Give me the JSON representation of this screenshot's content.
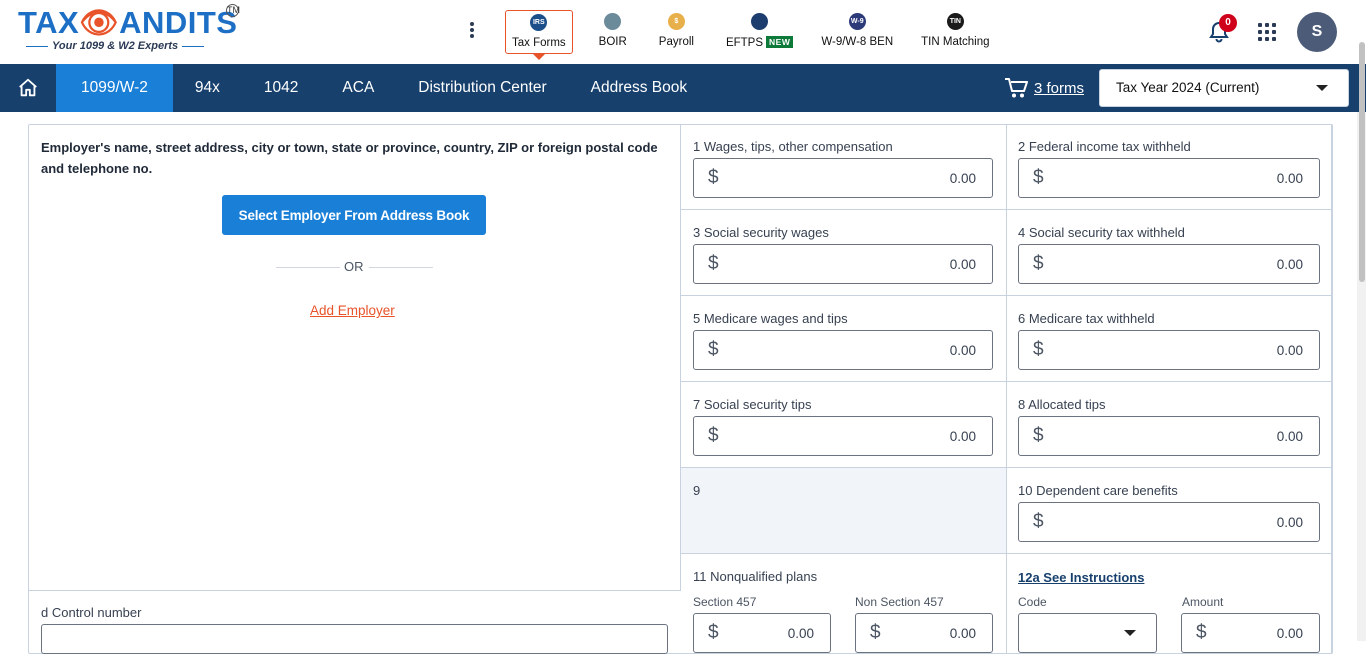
{
  "logo": {
    "brand_left": "TAX",
    "brand_right": "ANDITS",
    "tm": "TM",
    "tagline": "Your 1099 & W2 Experts"
  },
  "products": [
    {
      "label": "Tax Forms",
      "icon": "tax-forms-icon",
      "color": "#1c4f8a",
      "glyph": "IRS",
      "active": true
    },
    {
      "label": "BOIR",
      "icon": "boir-icon",
      "color": "#6b8a9a",
      "glyph": ""
    },
    {
      "label": "Payroll",
      "icon": "payroll-icon",
      "color": "#e8b04a",
      "glyph": "$"
    },
    {
      "label": "EFTPS",
      "icon": "eftps-icon",
      "color": "#1c3d6d",
      "glyph": "",
      "badge": "NEW"
    },
    {
      "label": "W-9/W-8 BEN",
      "icon": "w9-icon",
      "color": "#2d3a7a",
      "glyph": "W-9"
    },
    {
      "label": "TIN Matching",
      "icon": "tin-icon",
      "color": "#1a1a1a",
      "glyph": "TIN"
    }
  ],
  "notifications": {
    "count": "0"
  },
  "user": {
    "initial": "S"
  },
  "nav": {
    "tabs": [
      "1099/W-2",
      "94x",
      "1042",
      "ACA",
      "Distribution Center",
      "Address Book"
    ],
    "active_tab": "1099/W-2",
    "cart_label": "3 forms",
    "tax_year": "Tax Year 2024 (Current)"
  },
  "employer": {
    "label": "Employer's name, street address, city or town, state or province, country, ZIP or foreign postal code and telephone no.",
    "select_button": "Select Employer From Address Book",
    "or_text": "OR",
    "add_link": "Add Employer"
  },
  "control": {
    "label": "d  Control number"
  },
  "boxes": {
    "b1": {
      "label": "1  Wages, tips, other compensation",
      "currency": "$",
      "value": "0.00"
    },
    "b2": {
      "label": "2  Federal income tax withheld",
      "currency": "$",
      "value": "0.00"
    },
    "b3": {
      "label": "3  Social security wages",
      "currency": "$",
      "value": "0.00"
    },
    "b4": {
      "label": "4  Social security tax withheld",
      "currency": "$",
      "value": "0.00"
    },
    "b5": {
      "label": "5  Medicare wages and tips",
      "currency": "$",
      "value": "0.00"
    },
    "b6": {
      "label": "6  Medicare tax withheld",
      "currency": "$",
      "value": "0.00"
    },
    "b7": {
      "label": "7  Social security tips",
      "currency": "$",
      "value": "0.00"
    },
    "b8": {
      "label": "8  Allocated tips",
      "currency": "$",
      "value": "0.00"
    },
    "b9": {
      "label": "9"
    },
    "b10": {
      "label": "10 Dependent care benefits",
      "currency": "$",
      "value": "0.00"
    },
    "b11": {
      "label": "11  Nonqualified plans",
      "sec457_label": "Section 457",
      "sec457_value": "0.00",
      "nonsec457_label": "Non Section 457",
      "nonsec457_value": "0.00",
      "currency": "$"
    },
    "b12a": {
      "link": "12a See Instructions",
      "code_label": "Code",
      "amount_label": "Amount",
      "amount_value": "0.00",
      "currency": "$"
    }
  }
}
